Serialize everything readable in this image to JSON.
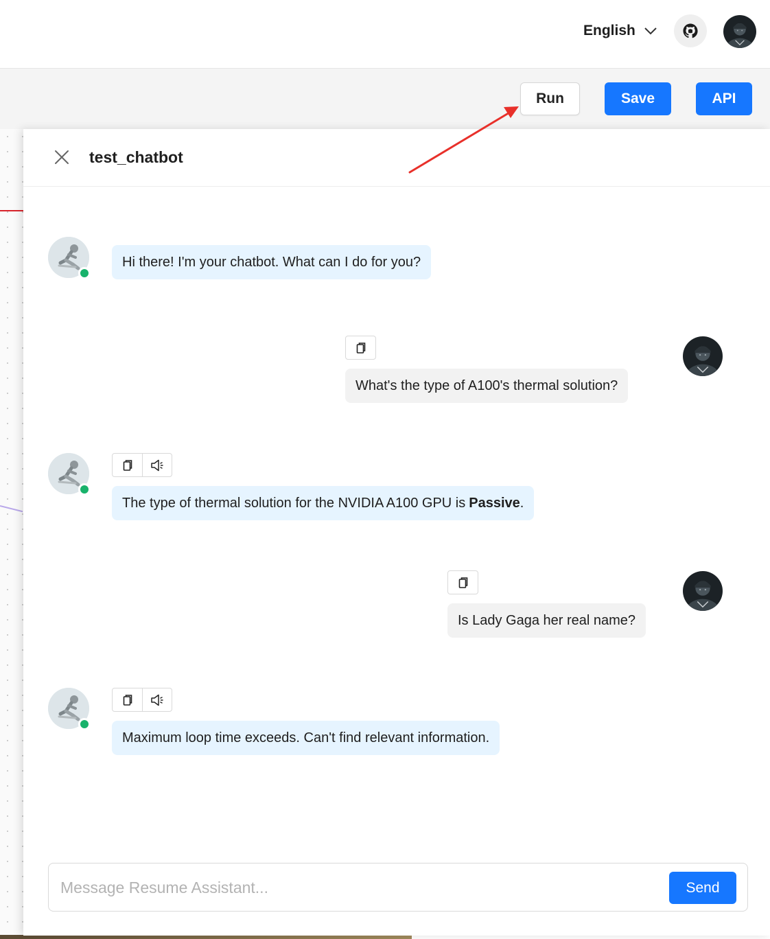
{
  "header": {
    "language": "English",
    "icons": {
      "language_dropdown": "chevron-down-icon",
      "github": "github-icon",
      "avatar": "user-avatar"
    }
  },
  "toolbar": {
    "run_label": "Run",
    "save_label": "Save",
    "api_label": "API",
    "colors": {
      "primary": "#1677ff",
      "annotation_arrow": "#e8302a"
    }
  },
  "chat": {
    "title": "test_chatbot",
    "messages": [
      {
        "role": "bot",
        "text": "Hi there! I'm your chatbot. What can I do for you?"
      },
      {
        "role": "user",
        "text": "What's the type of A100's thermal solution?"
      },
      {
        "role": "bot",
        "text": "The type of thermal solution for the NVIDIA A100 GPU is",
        "bold": "Passive",
        "suffix": "."
      },
      {
        "role": "user",
        "text": "Is Lady Gaga her real name?"
      },
      {
        "role": "bot",
        "text": "Maximum loop time exceeds. Can't find relevant information."
      }
    ],
    "input": {
      "placeholder": "Message Resume Assistant...",
      "value": ""
    },
    "send_label": "Send",
    "colors": {
      "bot_bubble": "#e6f4ff",
      "user_bubble": "#f2f2f2",
      "online_dot": "#18b26b"
    }
  }
}
